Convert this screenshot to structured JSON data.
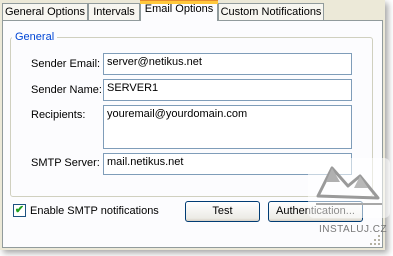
{
  "tabs": [
    {
      "label": "General Options",
      "active": false
    },
    {
      "label": "Intervals",
      "active": false
    },
    {
      "label": "Email Options",
      "active": true
    },
    {
      "label": "Custom Notifications",
      "active": false
    }
  ],
  "group": {
    "title": "General",
    "sender_email": {
      "label": "Sender Email:",
      "value": "server@netikus.net"
    },
    "sender_name": {
      "label": "Sender Name:",
      "value": "SERVER1"
    },
    "recipients": {
      "label": "Recipients:",
      "value": "youremail@yourdomain.com"
    },
    "smtp_server": {
      "label": "SMTP Server:",
      "value": "mail.netikus.net"
    }
  },
  "enable_smtp": {
    "label": "Enable SMTP notifications",
    "checked": true
  },
  "buttons": {
    "test": "Test",
    "authentication": "Authentication..."
  },
  "watermark": {
    "text": "INSTALUJ.CZ"
  },
  "colors": {
    "tab_highlight": "#ffc83c",
    "group_title": "#0046d5",
    "check": "#21a121"
  }
}
